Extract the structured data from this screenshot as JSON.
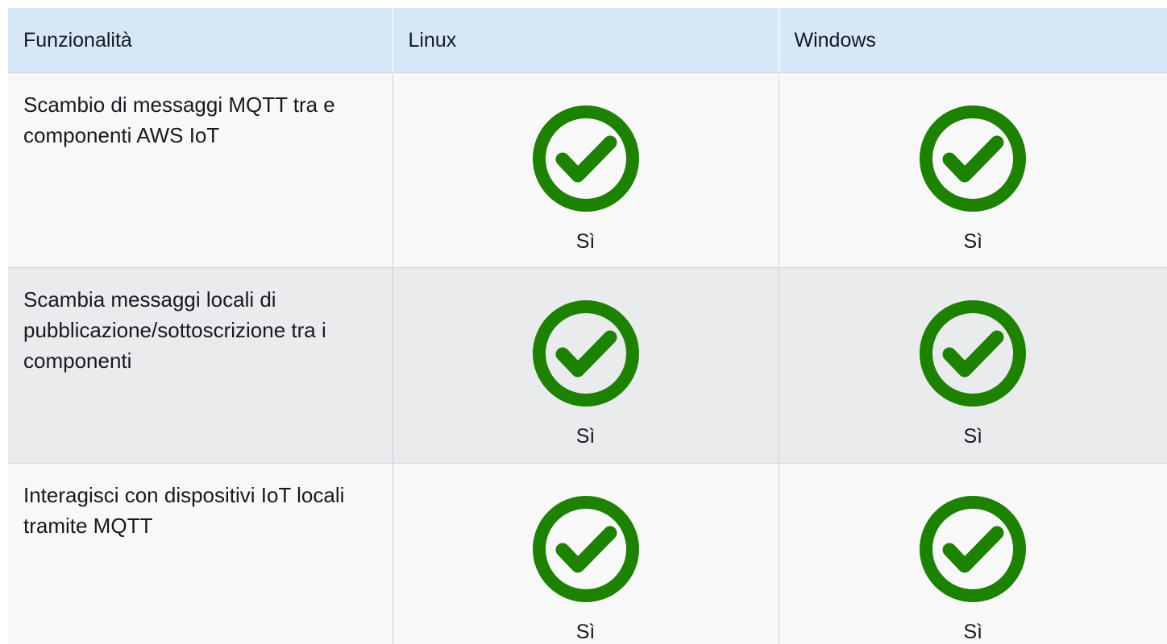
{
  "table": {
    "headers": [
      "Funzionalità",
      "Linux",
      "Windows"
    ],
    "rows": [
      {
        "feature": "Scambio di messaggi MQTT tra e componenti AWS IoT",
        "linux": {
          "icon": "check-circle-icon",
          "label": "Sì"
        },
        "windows": {
          "icon": "check-circle-icon",
          "label": "Sì"
        }
      },
      {
        "feature": "Scambia messaggi locali di pubblicazione/sottoscrizione tra i componenti",
        "linux": {
          "icon": "check-circle-icon",
          "label": "Sì"
        },
        "windows": {
          "icon": "check-circle-icon",
          "label": "Sì"
        }
      },
      {
        "feature": "Interagisci con dispositivi IoT locali tramite MQTT",
        "linux": {
          "icon": "check-circle-icon",
          "label": "Sì"
        },
        "windows": {
          "icon": "check-circle-icon",
          "label": "Sì"
        }
      }
    ]
  },
  "colors": {
    "header_bg": "#d6e8f8",
    "check_green": "#1d8102"
  }
}
